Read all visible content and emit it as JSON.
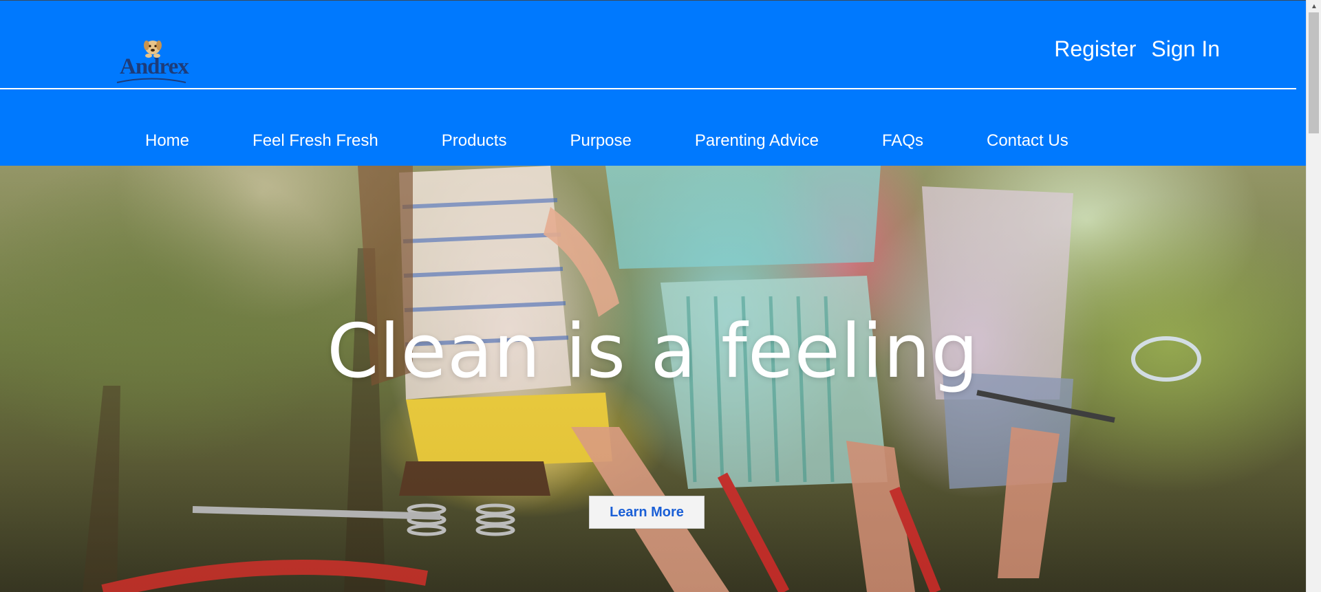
{
  "brand": {
    "logo_text": "Andrex",
    "header_color": "#0079fe"
  },
  "auth": {
    "register": "Register",
    "sign_in": "Sign In"
  },
  "nav": {
    "items": [
      {
        "label": "Home"
      },
      {
        "label": "Feel Fresh Fresh"
      },
      {
        "label": "Products"
      },
      {
        "label": "Purpose"
      },
      {
        "label": "Parenting Advice"
      },
      {
        "label": "FAQs"
      },
      {
        "label": "Contact Us"
      }
    ]
  },
  "hero": {
    "title": "Clean is a feeling",
    "cta_label": "Learn More",
    "cta_color": "#1a5fd6"
  },
  "icons": {
    "logo_mark": "puppy-icon",
    "scroll_up": "chevron-up-icon"
  }
}
